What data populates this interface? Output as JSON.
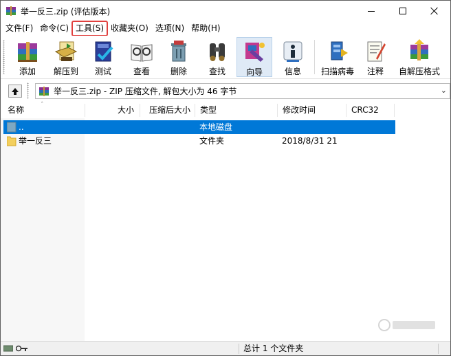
{
  "window": {
    "title": "举一反三.zip (评估版本)"
  },
  "menu": {
    "items": [
      {
        "label": "文件(F)"
      },
      {
        "label": "命令(C)"
      },
      {
        "label": "工具(S)"
      },
      {
        "label": "收藏夹(O)"
      },
      {
        "label": "选项(N)"
      },
      {
        "label": "帮助(H)"
      }
    ],
    "highlighted": "工具(S)"
  },
  "toolbar": {
    "buttons": [
      {
        "label": "添加",
        "icon": "add-archive-icon"
      },
      {
        "label": "解压到",
        "icon": "extract-to-icon"
      },
      {
        "label": "测试",
        "icon": "test-icon"
      },
      {
        "label": "查看",
        "icon": "view-icon"
      },
      {
        "label": "删除",
        "icon": "delete-icon"
      },
      {
        "label": "查找",
        "icon": "find-icon"
      },
      {
        "label": "向导",
        "icon": "wizard-icon"
      },
      {
        "label": "信息",
        "icon": "info-icon"
      },
      {
        "label": "扫描病毒",
        "icon": "virus-scan-icon"
      },
      {
        "label": "注释",
        "icon": "comment-icon"
      },
      {
        "label": "自解压格式",
        "icon": "sfx-icon"
      }
    ],
    "active": "向导"
  },
  "address": {
    "text": "举一反三.zip - ZIP 压缩文件, 解包大小为 46 字节"
  },
  "columns": [
    "名称",
    "大小",
    "压缩后大小",
    "类型",
    "修改时间",
    "CRC32"
  ],
  "rows": [
    {
      "name": "..",
      "size": "",
      "packed": "",
      "type": "本地磁盘",
      "modified": "",
      "crc": "",
      "selected": true
    },
    {
      "name": "举一反三",
      "size": "",
      "packed": "",
      "type": "文件夹",
      "modified": "2018/8/31 21",
      "crc": "",
      "selected": false
    }
  ],
  "status": {
    "text": "总计 1 个文件夹"
  },
  "colors": {
    "selection": "#0078d7",
    "highlight_outline": "#e0403e"
  }
}
